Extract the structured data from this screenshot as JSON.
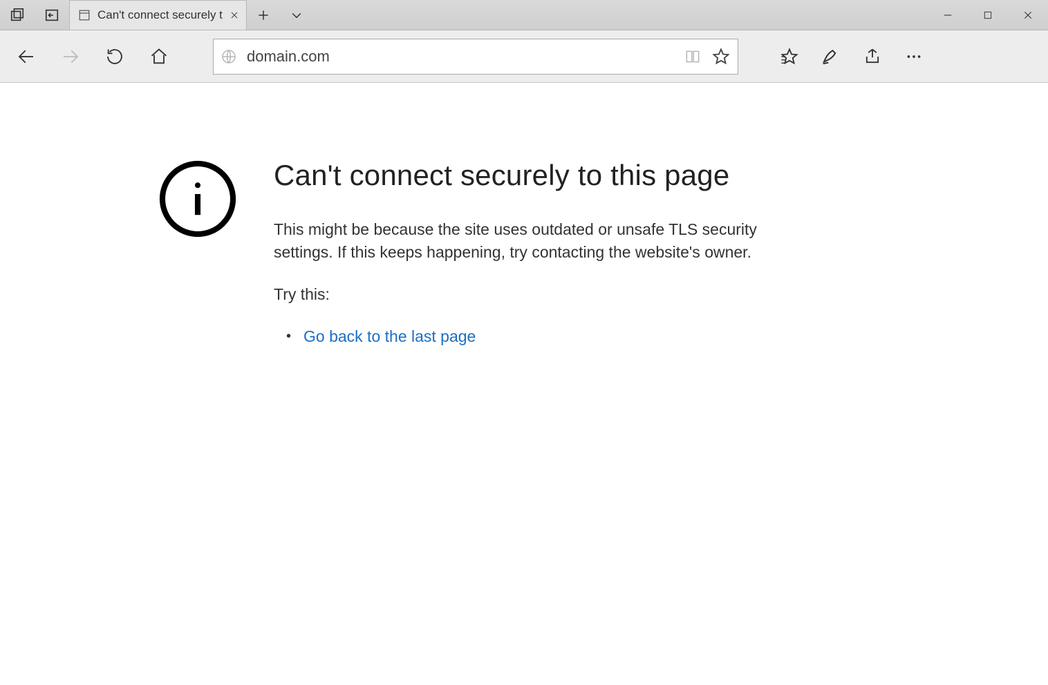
{
  "tab": {
    "title": "Can't connect securely t"
  },
  "address": {
    "url": "domain.com"
  },
  "page": {
    "heading": "Can't connect securely to this page",
    "description": "This might be because the site uses outdated or unsafe TLS security settings. If this keeps happening, try contacting the website's owner.",
    "try_label": "Try this:",
    "link": "Go back to the last page"
  }
}
